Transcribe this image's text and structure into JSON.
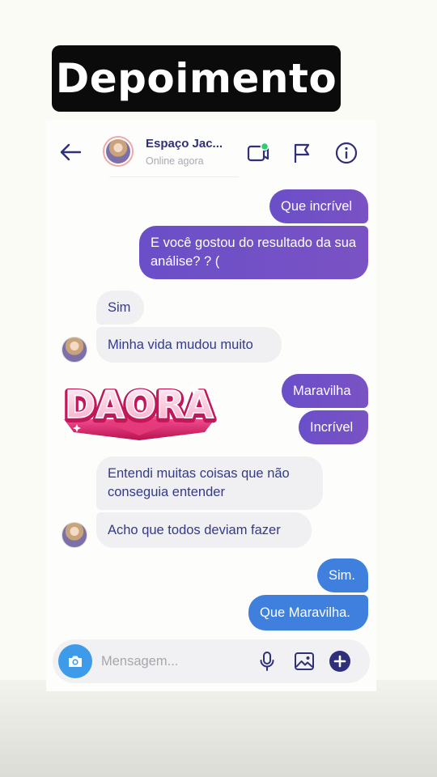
{
  "overlay": {
    "title": "Depoimento"
  },
  "header": {
    "contact_name": "Espaço Jac...",
    "status": "Online agora"
  },
  "messages": [
    {
      "dir": "out",
      "text": "Que incrível"
    },
    {
      "dir": "out",
      "text": "E você  gostou do resultado da sua análise? ? ("
    },
    {
      "dir": "in",
      "text": "Sim"
    },
    {
      "dir": "in",
      "text": "Minha vida mudou muito"
    },
    {
      "dir": "in",
      "sticker": "DAORA"
    },
    {
      "dir": "out",
      "text": "Maravilha"
    },
    {
      "dir": "out",
      "text": "Incrível"
    },
    {
      "dir": "in",
      "text": "Entendi muitas coisas que não conseguia entender"
    },
    {
      "dir": "in",
      "text": "Acho que todos deviam fazer"
    },
    {
      "dir": "out",
      "text": "Sim."
    },
    {
      "dir": "out",
      "text": "Que Maravilha."
    }
  ],
  "composer": {
    "placeholder": "Mensagem..."
  },
  "icons": {
    "back": "arrow-left-icon",
    "video": "video-call-icon",
    "flag": "flag-icon",
    "info": "info-icon",
    "camera": "camera-icon",
    "mic": "microphone-icon",
    "gallery": "image-gallery-icon",
    "plus": "plus-icon"
  },
  "colors": {
    "accent": "#2f2f7a",
    "outgoing_bubble": "#6a4fc8",
    "outgoing_bubble_alt": "#3f7fdd",
    "incoming_bubble": "#f0f0f2",
    "online_dot": "#2ecc71",
    "camera_button": "#3d9be9"
  }
}
